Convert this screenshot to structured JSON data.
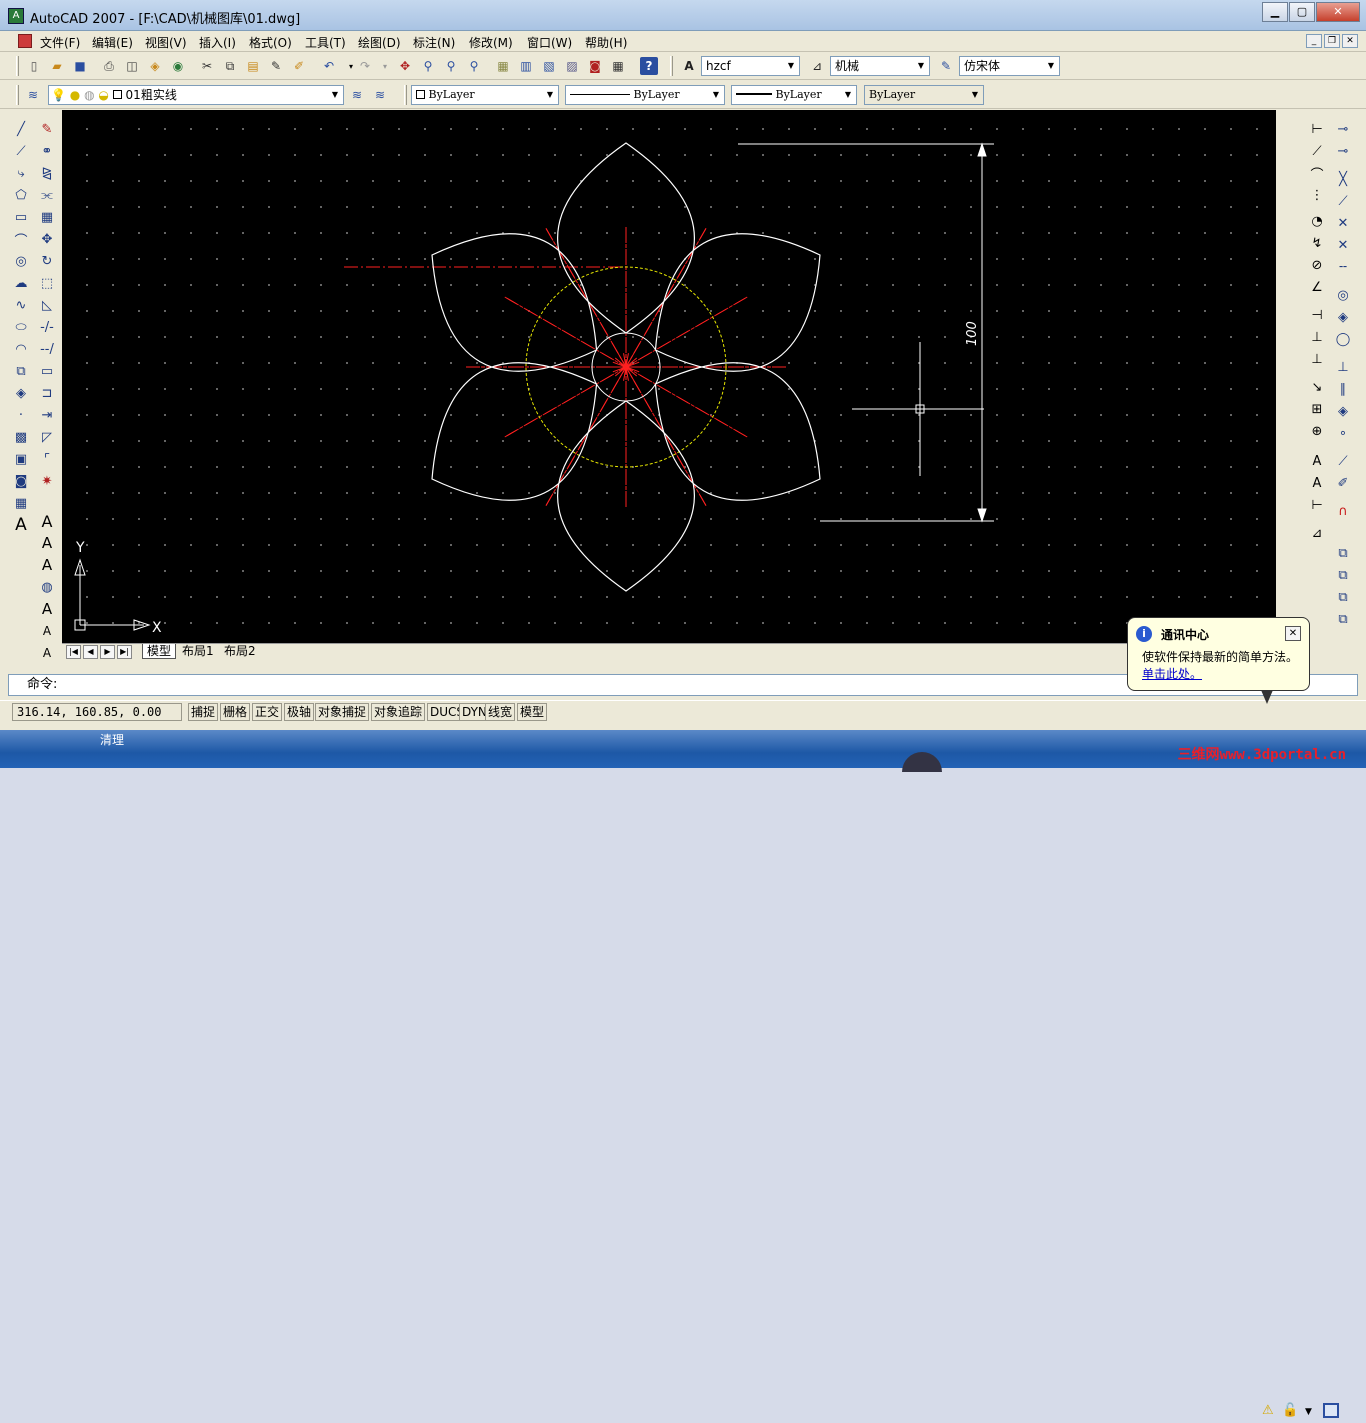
{
  "window": {
    "title": "AutoCAD 2007 - [F:\\CAD\\机械图库\\01.dwg]",
    "app_icon": "autocad-icon"
  },
  "menu": [
    "文件(F)",
    "编辑(E)",
    "视图(V)",
    "插入(I)",
    "格式(O)",
    "工具(T)",
    "绘图(D)",
    "标注(N)",
    "修改(M)",
    "窗口(W)",
    "帮助(H)"
  ],
  "toolbar1": {
    "text_style": "hzcf",
    "dim_style": "机械",
    "font": "仿宋体"
  },
  "toolbar2": {
    "layer": "01粗实线",
    "color": "ByLayer",
    "linetype": "ByLayer",
    "lineweight": "ByLayer",
    "plotstyle": "ByLayer"
  },
  "drawing": {
    "dimension_text": "100",
    "axis_x": "X",
    "axis_y": "Y",
    "circle_color": "#e6e600",
    "center_color": "#ff0000",
    "petal_color": "#ffffff"
  },
  "tabs": [
    "模型",
    "布局1",
    "布局2"
  ],
  "command": {
    "prompt": "命令:"
  },
  "status": {
    "coords": "316.14,  160.85,  0.00",
    "buttons": [
      "捕捉",
      "栅格",
      "正交",
      "极轴",
      "对象捕捉",
      "对象追踪",
      "DUCS",
      "DYN",
      "线宽",
      "模型"
    ]
  },
  "balloon": {
    "title": "通讯中心",
    "text": "使软件保持最新的简单方法。",
    "link": "单击此处。"
  },
  "taskbar": {
    "label": "清理",
    "watermark": "三维网www.3dportal.cn"
  }
}
